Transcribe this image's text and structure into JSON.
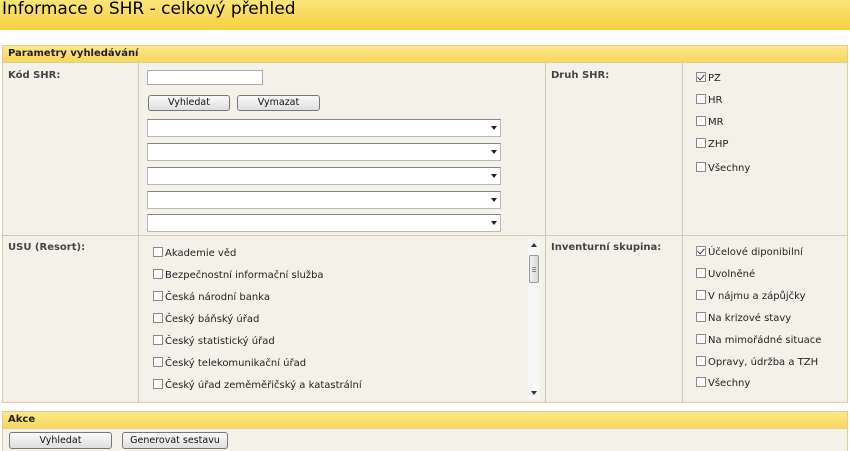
{
  "page": {
    "title": "Informace o SHR - celkový přehled"
  },
  "search_params": {
    "header": "Parametry vyhledávání",
    "kod_shr": {
      "label": "Kód SHR:",
      "value": "",
      "search_button": "Vyhledat",
      "clear_button": "Vymazat",
      "dropdowns": [
        "",
        "",
        "",
        "",
        ""
      ]
    },
    "druh_shr": {
      "label": "Druh SHR:",
      "options": [
        {
          "label": "PZ",
          "checked": true
        },
        {
          "label": "HR",
          "checked": false
        },
        {
          "label": "MR",
          "checked": false
        },
        {
          "label": "ZHP",
          "checked": false
        },
        {
          "label": "Všechny",
          "checked": false
        }
      ]
    },
    "usu": {
      "label": "USU (Resort):",
      "options": [
        {
          "label": "Akademie věd",
          "checked": false
        },
        {
          "label": "Bezpečnostní informační služba",
          "checked": false
        },
        {
          "label": "Česká národní banka",
          "checked": false
        },
        {
          "label": "Český báňský úřad",
          "checked": false
        },
        {
          "label": "Český statistický úřad",
          "checked": false
        },
        {
          "label": "Český telekomunikační úřad",
          "checked": false
        },
        {
          "label": "Český úřad zeměměřičský a katastrální",
          "checked": false
        }
      ]
    },
    "inventurni_skupina": {
      "label": "Inventurní skupina:",
      "options": [
        {
          "label": "Účelové diponibilní",
          "checked": true
        },
        {
          "label": "Uvolněné",
          "checked": false
        },
        {
          "label": "V nájmu a zápůjčky",
          "checked": false
        },
        {
          "label": "Na krizové stavy",
          "checked": false
        },
        {
          "label": "Na mimořádné situace",
          "checked": false
        },
        {
          "label": "Opravy, údržba a TZH",
          "checked": false
        },
        {
          "label": "Všechny",
          "checked": false
        }
      ]
    }
  },
  "actions": {
    "header": "Akce",
    "search_button": "Vyhledat",
    "report_button": "Generovat sestavu"
  }
}
